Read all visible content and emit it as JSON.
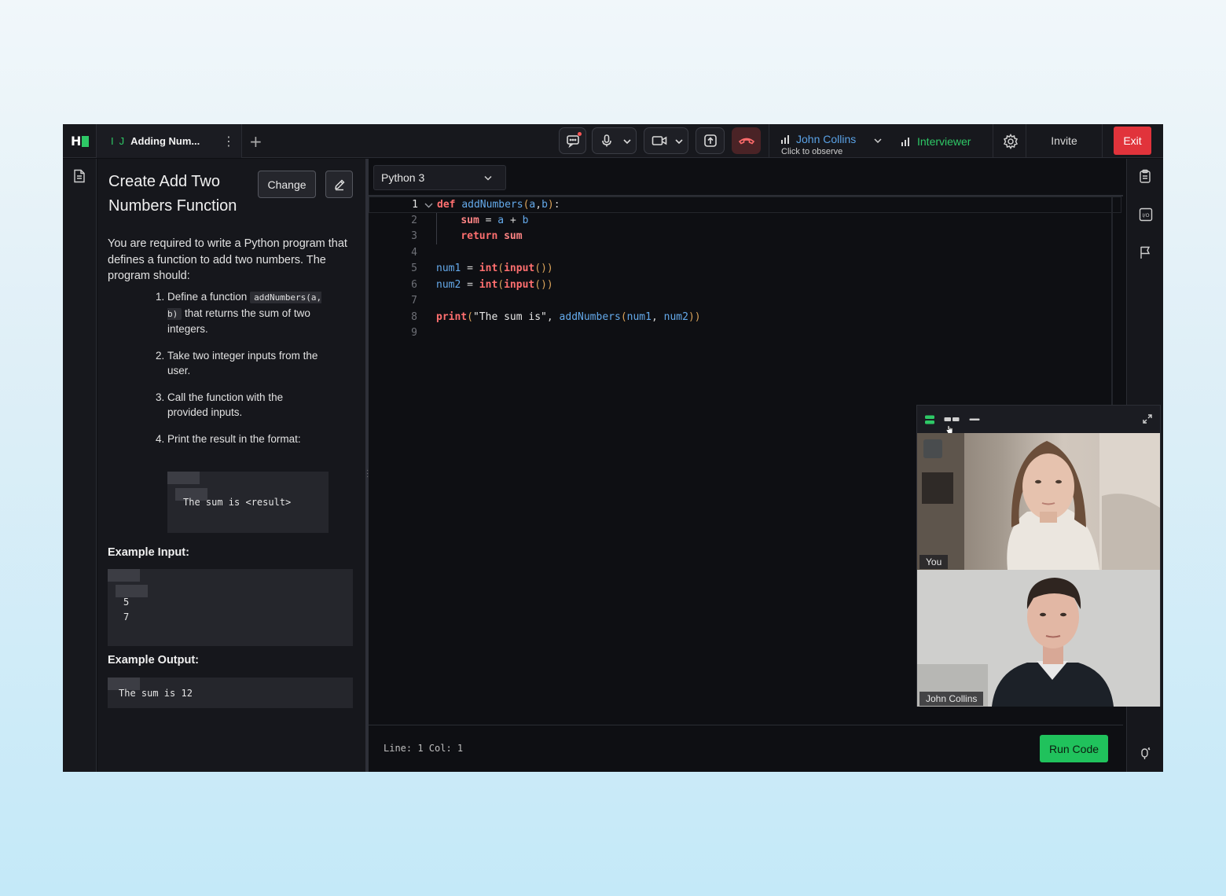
{
  "topbar": {
    "logo": "H",
    "tab": {
      "status_dot": "I",
      "initial": "J",
      "title": "Adding Num...",
      "menu_icon": "kebab-icon"
    },
    "add_tab_icon": "plus-icon",
    "controls": [
      "chat-icon",
      "microphone-icon",
      "camera-icon",
      "share-screen-icon",
      "end-call-icon"
    ],
    "observer": {
      "name": "John Collins",
      "hint": "Click to observe"
    },
    "role": {
      "name": "Interviewer"
    },
    "settings_icon": "gear-icon",
    "invite_label": "Invite",
    "exit_label": "Exit"
  },
  "problem": {
    "title": "Create Add Two Numbers Function",
    "change_label": "Change",
    "edit_icon": "pencil-icon",
    "description": "You are required to write a Python program that defines a function to add two numbers. The program should:",
    "steps": [
      {
        "num": "1.",
        "pre": "Define a function ",
        "code": "addNumbers(a, b)",
        "post": " that returns the sum of two integers."
      },
      {
        "num": "2.",
        "pre": "Take two integer inputs from the user.",
        "code": "",
        "post": ""
      },
      {
        "num": "3.",
        "pre": "Call the function with the provided inputs.",
        "code": "",
        "post": ""
      },
      {
        "num": "4.",
        "pre": "Print the result in the format:",
        "code": "",
        "post": ""
      }
    ],
    "format_text": "The sum is <result>",
    "example_input_heading": "Example Input:",
    "example_input_lines": [
      "5",
      "7"
    ],
    "example_output_heading": "Example Output:",
    "example_output_text": "The sum is 12"
  },
  "editor": {
    "language": "Python 3",
    "line_numbers": [
      "1",
      "2",
      "3",
      "4",
      "5",
      "6",
      "7",
      "8",
      "9"
    ],
    "code_lines": [
      "def addNumbers(a,b):",
      "    sum = a + b",
      "    return sum",
      "",
      "num1 = int(input())",
      "num2 = int(input())",
      "",
      "print(\"The sum is\", addNumbers(num1, num2))",
      ""
    ],
    "cursor_position": "Line: 1 Col: 1",
    "run_label": "Run Code"
  },
  "right_rail": {
    "icons": [
      "clipboard-icon",
      "io-icon",
      "flag-icon",
      "magic-icon"
    ]
  },
  "video": {
    "layout_icons": [
      "stacked-layout-icon",
      "grid-layout-icon",
      "minimize-icon"
    ],
    "expand_icon": "expand-icon",
    "participants": [
      {
        "label": "You"
      },
      {
        "label": "John Collins"
      }
    ]
  },
  "colors": {
    "brand_green": "#2ec866",
    "exit_red": "#e1333b",
    "link_blue": "#5aa2e6",
    "run_green": "#20c25c"
  }
}
